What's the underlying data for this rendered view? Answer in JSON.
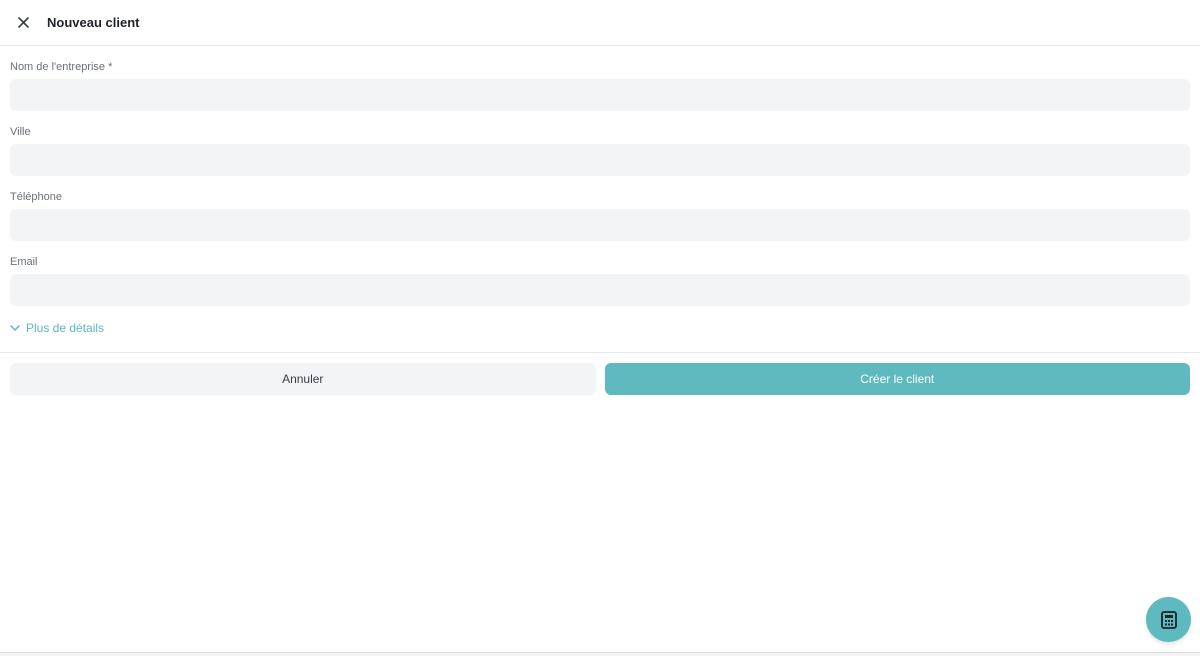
{
  "header": {
    "title": "Nouveau client",
    "close_icon": "close-icon"
  },
  "form": {
    "fields": [
      {
        "label": "Nom de l'entreprise *",
        "value": "",
        "placeholder": ""
      },
      {
        "label": "Ville",
        "value": "",
        "placeholder": ""
      },
      {
        "label": "Téléphone",
        "value": "",
        "placeholder": ""
      },
      {
        "label": "Email",
        "value": "",
        "placeholder": ""
      }
    ],
    "more_details": {
      "label": "Plus de détails",
      "icon": "chevron-down-icon"
    }
  },
  "actions": {
    "cancel_label": "Annuler",
    "create_label": "Créer le client"
  },
  "fab": {
    "icon": "calculator-icon"
  },
  "colors": {
    "accent": "#5fbac0",
    "input_bg": "#f2f4f5",
    "divider": "#e6e8eb",
    "link": "#5bb7bd"
  }
}
